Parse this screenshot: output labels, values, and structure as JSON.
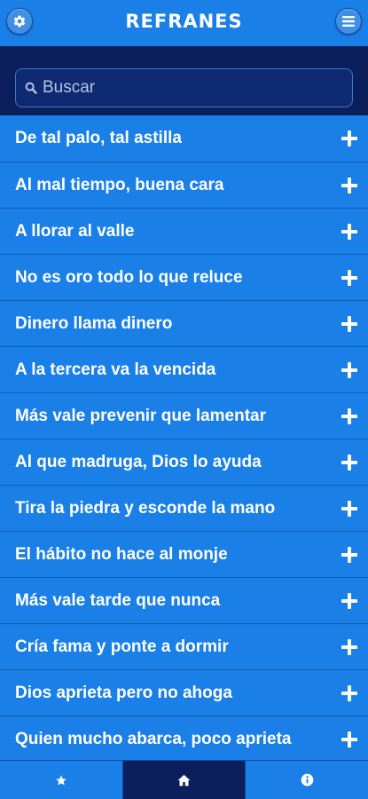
{
  "header": {
    "title": "REFRANES",
    "left_icon": "gear-icon",
    "right_icon": "menu-icon"
  },
  "search": {
    "placeholder": "Buscar",
    "value": ""
  },
  "proverbs": [
    "De tal palo, tal astilla",
    "Al mal tiempo, buena cara",
    "A llorar al valle",
    "No es oro todo lo que reluce",
    "Dinero llama dinero",
    "A la tercera va la vencida",
    "Más vale prevenir que lamentar",
    "Al que madruga, Dios lo ayuda",
    "Tira la piedra y esconde la mano",
    "El hábito no hace al monje",
    "Más vale tarde que nunca",
    "Cría fama y ponte a dormir",
    "Dios aprieta pero no ahoga",
    "Quien mucho abarca, poco aprieta"
  ],
  "tabs": [
    {
      "icon": "star-icon",
      "active": false
    },
    {
      "icon": "home-icon",
      "active": true
    },
    {
      "icon": "info-icon",
      "active": false
    }
  ],
  "colors": {
    "primary": "#1a7fe6",
    "dark": "#0a1f5c",
    "text": "#ffffff"
  }
}
